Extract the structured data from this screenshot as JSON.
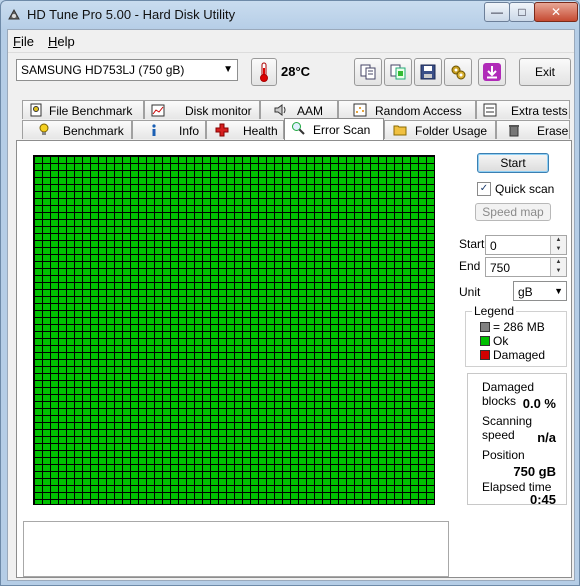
{
  "window": {
    "title": "HD Tune Pro 5.00 - Hard Disk Utility",
    "minimize_glyph": "—",
    "maximize_glyph": "□",
    "close_glyph": "✕"
  },
  "menu": {
    "file": "File",
    "help": "Help"
  },
  "toolbar": {
    "drive": "SAMSUNG HD753LJ (750 gB)",
    "temperature": "28°C",
    "exit_label": "Exit",
    "icons": [
      "copy-text-icon",
      "copy-screenshot-icon",
      "save-icon",
      "options-icon",
      "download-icon"
    ]
  },
  "tabs_top": [
    {
      "label": "File Benchmark",
      "icon": "file-benchmark-icon"
    },
    {
      "label": "Disk monitor",
      "icon": "disk-monitor-icon"
    },
    {
      "label": "AAM",
      "icon": "speaker-icon"
    },
    {
      "label": "Random Access",
      "icon": "random-access-icon"
    },
    {
      "label": "Extra tests",
      "icon": "extra-tests-icon"
    }
  ],
  "tabs_bottom": [
    {
      "label": "Benchmark",
      "icon": "lightbulb-icon"
    },
    {
      "label": "Info",
      "icon": "info-icon"
    },
    {
      "label": "Health",
      "icon": "health-cross-icon"
    },
    {
      "label": "Error Scan",
      "icon": "magnifier-icon",
      "active": true
    },
    {
      "label": "Folder Usage",
      "icon": "folder-icon"
    },
    {
      "label": "Erase",
      "icon": "trash-icon"
    }
  ],
  "scan": {
    "start_button": "Start",
    "quick_scan_label": "Quick scan",
    "quick_scan_checked": true,
    "speed_map_button": "Speed map",
    "start_label": "Start",
    "start_value": "0",
    "end_label": "End",
    "end_value": "750",
    "unit_label": "Unit",
    "unit_value": "gB"
  },
  "legend": {
    "title": "Legend",
    "block_size": "= 286 MB",
    "ok": "Ok",
    "damaged": "Damaged",
    "colors": {
      "block": "#808080",
      "ok": "#00c000",
      "damaged": "#d00000"
    }
  },
  "stats": {
    "damaged_blocks_label": "Damaged blocks",
    "damaged_blocks_value": "0.0 %",
    "scanning_speed_label": "Scanning speed",
    "scanning_speed_value": "n/a",
    "position_label": "Position",
    "position_value": "750 gB",
    "elapsed_label": "Elapsed time",
    "elapsed_value": "0:45"
  },
  "colors": {
    "ok_block": "#00c000",
    "grid_line": "#000000"
  }
}
